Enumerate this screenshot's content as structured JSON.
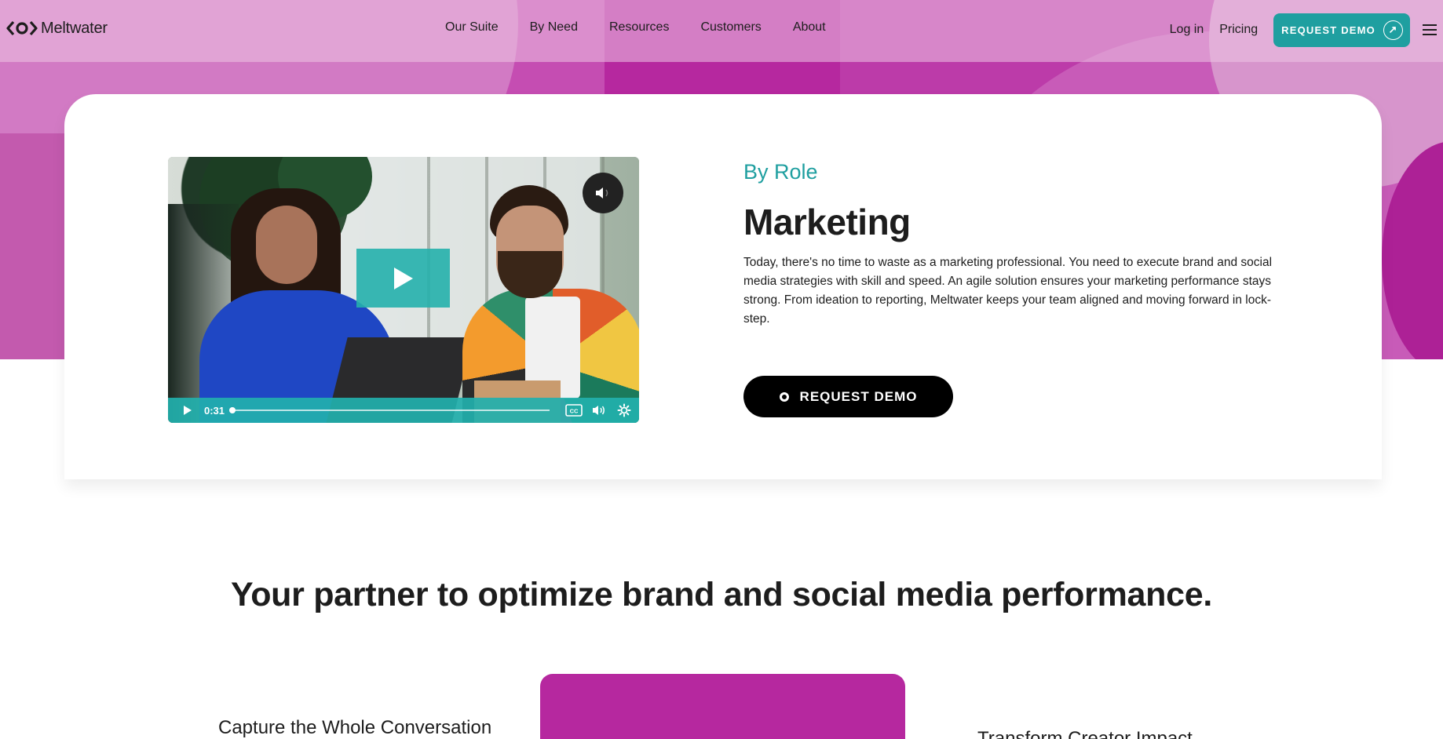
{
  "brand": {
    "name": "Meltwater"
  },
  "nav": {
    "links": [
      "Our Suite",
      "By Need",
      "Resources",
      "Customers",
      "About"
    ],
    "login": "Log in",
    "pricing": "Pricing",
    "demo_label": "REQUEST DEMO"
  },
  "hero": {
    "eyebrow": "By Role",
    "title": "Marketing",
    "description": "Today, there's no time to waste as a marketing professional. You need to execute brand and social media strategies with skill and speed. An agile solution ensures your marketing performance stays strong. From ideation to reporting, Meltwater keeps your team aligned and moving forward in lock-step.",
    "demo_label": "REQUEST DEMO",
    "video": {
      "time": "0:31",
      "progress": 0.0
    }
  },
  "section": {
    "heading": "Your partner to optimize brand and social media performance.",
    "features": [
      "Capture the Whole Conversation",
      "Transform Creator Impact"
    ]
  },
  "colors": {
    "accent_teal": "#1f9fa0",
    "brand_magenta": "#b6289f",
    "button_black": "#000000"
  }
}
